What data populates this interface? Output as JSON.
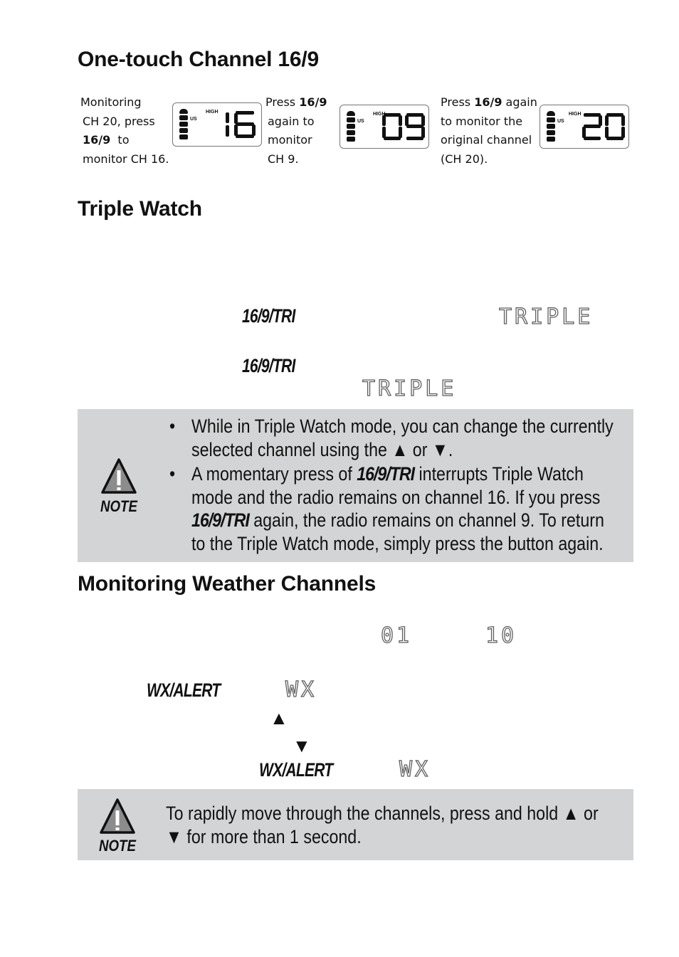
{
  "sections": {
    "onetouch": {
      "title": "One-touch Channel 16/9",
      "steps": [
        {
          "lines": [
            "Monitoring",
            "CH 20, press",
            "16/9  to",
            "monitor CH 16."
          ],
          "bold_line": 2,
          "bold_text": "16/9",
          "display": {
            "us": "US",
            "power": "HIGH",
            "channel": "16"
          }
        },
        {
          "lines": [
            "Press 16/9",
            "again to",
            "monitor",
            "CH 9."
          ],
          "display": {
            "us": "US",
            "power": "HIGH",
            "channel": "09"
          }
        },
        {
          "lines": [
            "Press 16/9 again",
            "to monitor the",
            "original channel",
            "(CH 20)."
          ],
          "display": {
            "us": "US",
            "power": "HIGH",
            "channel": "20"
          }
        }
      ],
      "step1_line1": "Monitoring",
      "step1_line2": "CH 20, press",
      "step1_line3_bold": "16/9",
      "step1_line3_rest": "to",
      "step1_line4": "monitor CH 16.",
      "step2_line1_pre": "Press ",
      "step2_line1_bold": "16/9",
      "step2_line2": "again to",
      "step2_line3": "monitor",
      "step2_line4": "CH 9.",
      "step3_line1_pre": "Press ",
      "step3_line1_bold": "16/9",
      "step3_line1_post": " again",
      "step3_line2": "to monitor the",
      "step3_line3": "original channel",
      "step3_line4": "(CH 20).",
      "lcd_us": "US",
      "lcd_high": "HIGH"
    },
    "triple": {
      "title": "Triple Watch",
      "key1": "16/9/TRI",
      "display1": "TRIPLE",
      "key2": "16/9/TRI",
      "display2": "TRIPLE"
    },
    "note1": {
      "label": "NOTE",
      "bullet": "•",
      "item1_a": "While in Triple Watch mode, you can change the currently",
      "item1_b": "selected channel using the ▲ or ▼.",
      "item2_a_pre": "A momentary press of ",
      "item2_a_key": "16/9/TRI",
      "item2_a_post": " interrupts Triple Watch",
      "item2_b": "mode and the radio remains on channel 16. If you press",
      "item2_c_key": "16/9/TRI",
      "item2_c_post": " again, the radio remains on channel 9. To return",
      "item2_d": "to the Triple Watch mode, simply press the button again."
    },
    "weather": {
      "title": "Monitoring Weather Channels",
      "channel_first": "01",
      "channel_last": "10",
      "key1": "WX/ALERT",
      "display1": "WX",
      "up_arrow": "▲",
      "down_arrow": "▼",
      "key2": "WX/ALERT",
      "display2": "WX"
    },
    "note2": {
      "label": "NOTE",
      "line1": "To rapidly move through the channels, press and hold ▲ or",
      "line2": "▼ for more than 1 second."
    }
  }
}
